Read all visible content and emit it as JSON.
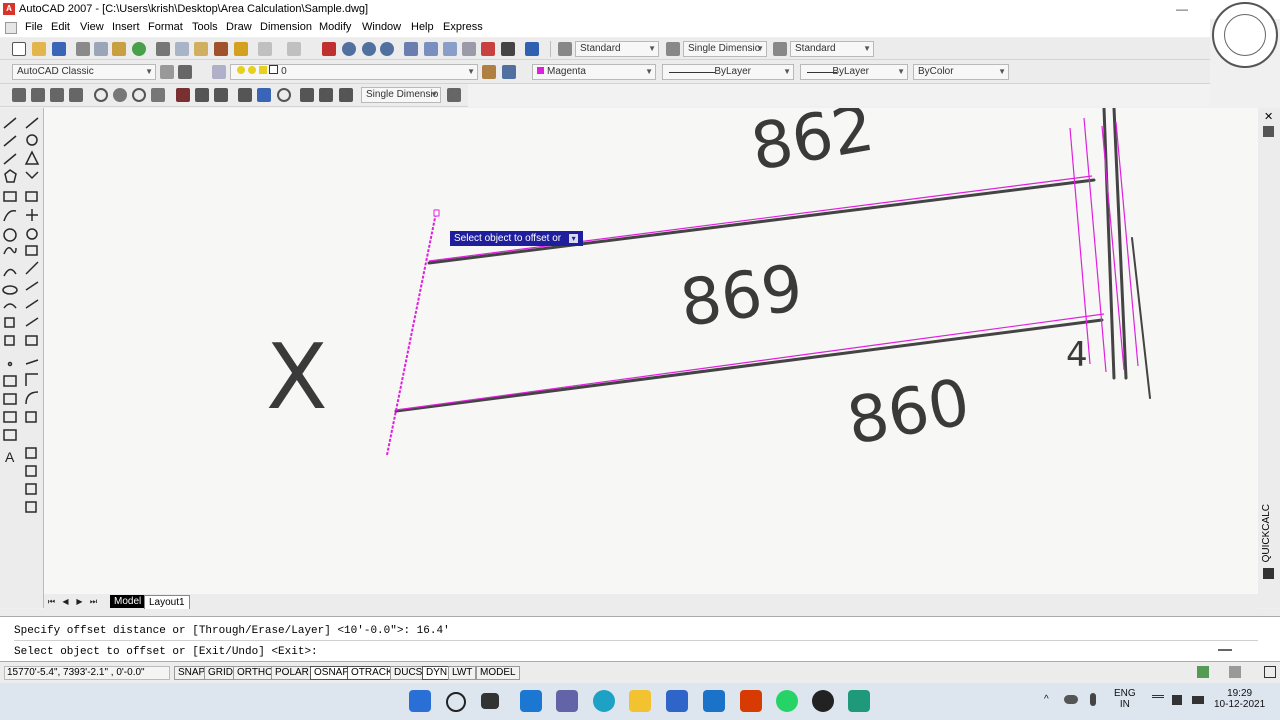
{
  "window": {
    "title": "AutoCAD 2007 - [C:\\Users\\krish\\Desktop\\Area Calculation\\Sample.dwg]",
    "app_icon": "A",
    "minimize": "—"
  },
  "menu": [
    "File",
    "Edit",
    "View",
    "Insert",
    "Format",
    "Tools",
    "Draw",
    "Dimension",
    "Modify",
    "Window",
    "Help",
    "Express"
  ],
  "toolbar1": {
    "text_style": "Standard",
    "dim_style": "Single Dimensio",
    "table_style": "Standard"
  },
  "toolbar2": {
    "workspace": "AutoCAD Classic",
    "layer": "0",
    "color": "Magenta",
    "linetype": "ByLayer",
    "lineweight": "ByLayer",
    "plotstyle": "ByColor"
  },
  "toolbar3": {
    "dim_style": "Single Dimensio"
  },
  "canvas": {
    "labels": [
      "862",
      "869",
      "860",
      "X",
      "4"
    ],
    "tooltip": "Select object to offset or",
    "tooltip_icon": "arrow-down-icon",
    "accent_color": "#e020e0"
  },
  "right_panel": {
    "close": "✕",
    "quickcalc": "QUICKCALC"
  },
  "tabs": {
    "model": "Model",
    "layout1": "Layout1"
  },
  "command": {
    "line1": "Specify offset distance or [Through/Erase/Layer] <10'-0.0\">: 16.4'",
    "line2": "Select object to offset or [Exit/Undo] <Exit>:"
  },
  "status": {
    "coords": "15770'-5.4\",  7393'-2.1\" , 0'-0.0\"",
    "buttons": [
      "SNAP",
      "GRID",
      "ORTHO",
      "POLAR",
      "OSNAP",
      "OTRACK",
      "DUCS",
      "DYN",
      "LWT",
      "MODEL"
    ]
  },
  "tray": {
    "lang1": "ENG",
    "lang2": "IN",
    "time": "19:29",
    "date": "10-12-2021"
  }
}
